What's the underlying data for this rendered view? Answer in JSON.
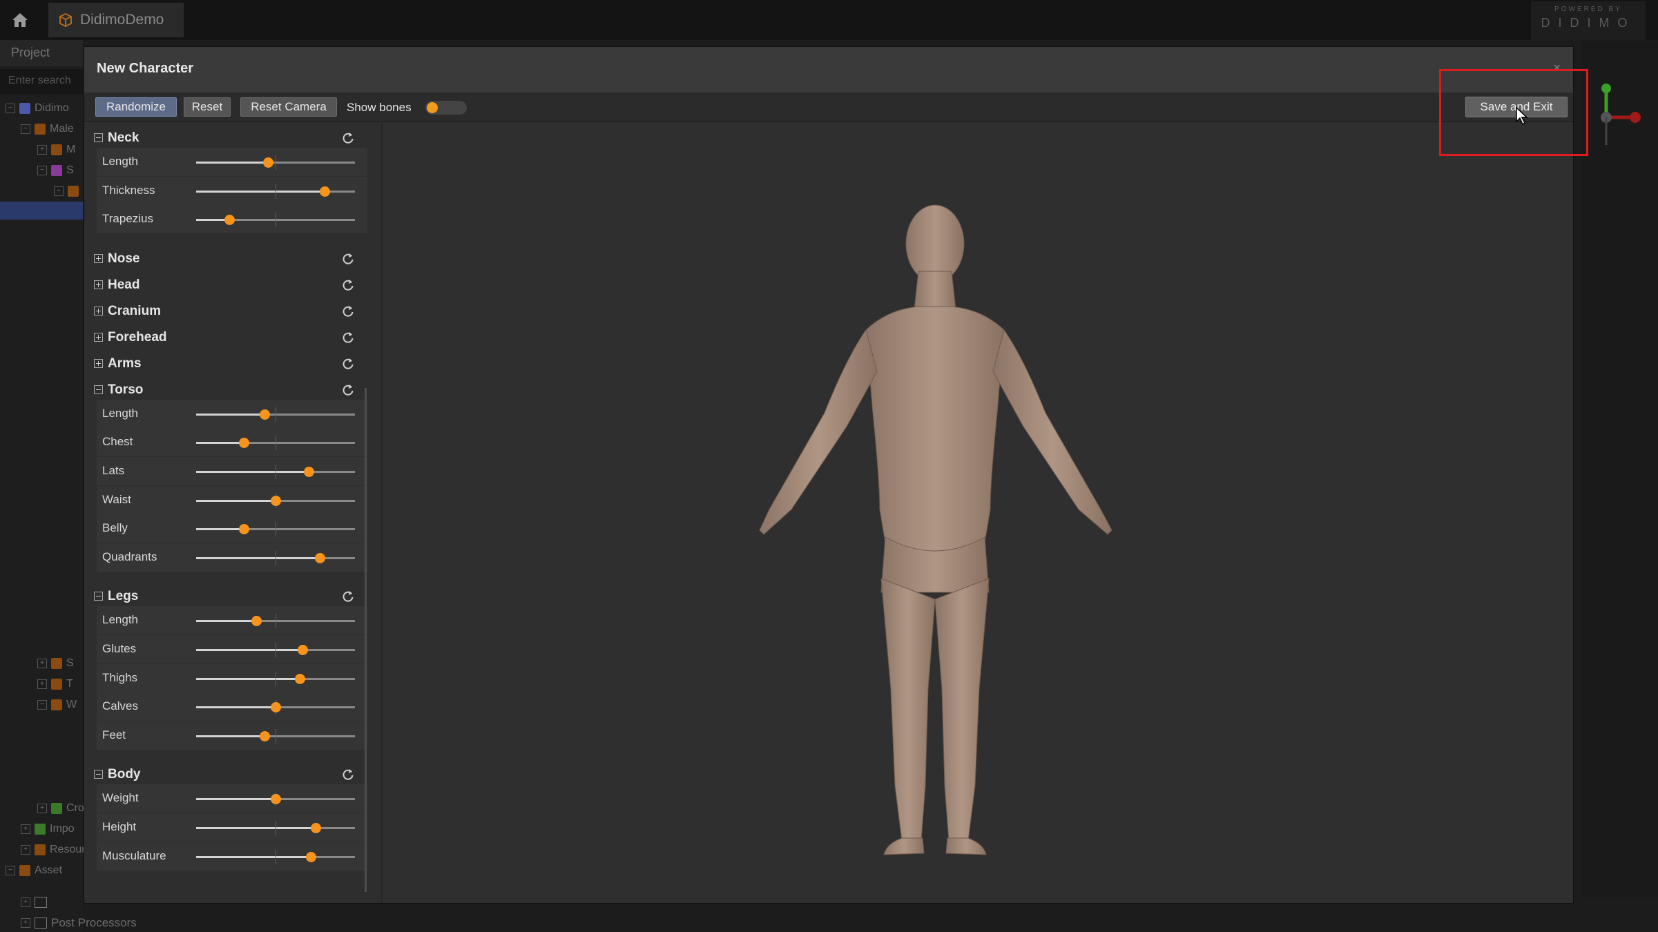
{
  "app": {
    "tab_title": "DidimoDemo",
    "powered_by": "POWERED BY",
    "brand": "DIDIMO"
  },
  "project_panel": {
    "header": "Project",
    "search_placeholder": "Enter search",
    "items": [
      "Didimo",
      "Male",
      "M",
      "S",
      "S",
      "T",
      "W",
      "Crow",
      "Impo",
      "Resour",
      "Asset",
      "Post Processors"
    ]
  },
  "modal": {
    "title": "New Character",
    "close_label": "×",
    "toolbar": {
      "randomize": "Randomize",
      "reset": "Reset",
      "reset_camera": "Reset Camera",
      "show_bones": "Show bones",
      "save_and_exit": "Save and Exit"
    }
  },
  "colors": {
    "accent": "#f7941d",
    "highlight_box": "#e01b1b"
  },
  "sections": [
    {
      "name": "Neck",
      "expanded": true,
      "sliders": [
        {
          "label": "Length",
          "value": 0.45
        },
        {
          "label": "Thickness",
          "value": 0.81
        },
        {
          "label": "Trapezius",
          "value": 0.21
        }
      ]
    },
    {
      "name": "Nose",
      "expanded": false,
      "sliders": []
    },
    {
      "name": "Head",
      "expanded": false,
      "sliders": []
    },
    {
      "name": "Cranium",
      "expanded": false,
      "sliders": []
    },
    {
      "name": "Forehead",
      "expanded": false,
      "sliders": []
    },
    {
      "name": "Arms",
      "expanded": false,
      "sliders": []
    },
    {
      "name": "Torso",
      "expanded": true,
      "sliders": [
        {
          "label": "Length",
          "value": 0.43
        },
        {
          "label": "Chest",
          "value": 0.3
        },
        {
          "label": "Lats",
          "value": 0.71
        },
        {
          "label": "Waist",
          "value": 0.5
        },
        {
          "label": "Belly",
          "value": 0.3
        },
        {
          "label": "Quadrants",
          "value": 0.78
        }
      ]
    },
    {
      "name": "Legs",
      "expanded": true,
      "sliders": [
        {
          "label": "Length",
          "value": 0.38
        },
        {
          "label": "Glutes",
          "value": 0.67
        },
        {
          "label": "Thighs",
          "value": 0.65
        },
        {
          "label": "Calves",
          "value": 0.5
        },
        {
          "label": "Feet",
          "value": 0.43
        }
      ]
    },
    {
      "name": "Body",
      "expanded": true,
      "sliders": [
        {
          "label": "Weight",
          "value": 0.5
        },
        {
          "label": "Height",
          "value": 0.75
        },
        {
          "label": "Musculature",
          "value": 0.72
        }
      ]
    }
  ]
}
